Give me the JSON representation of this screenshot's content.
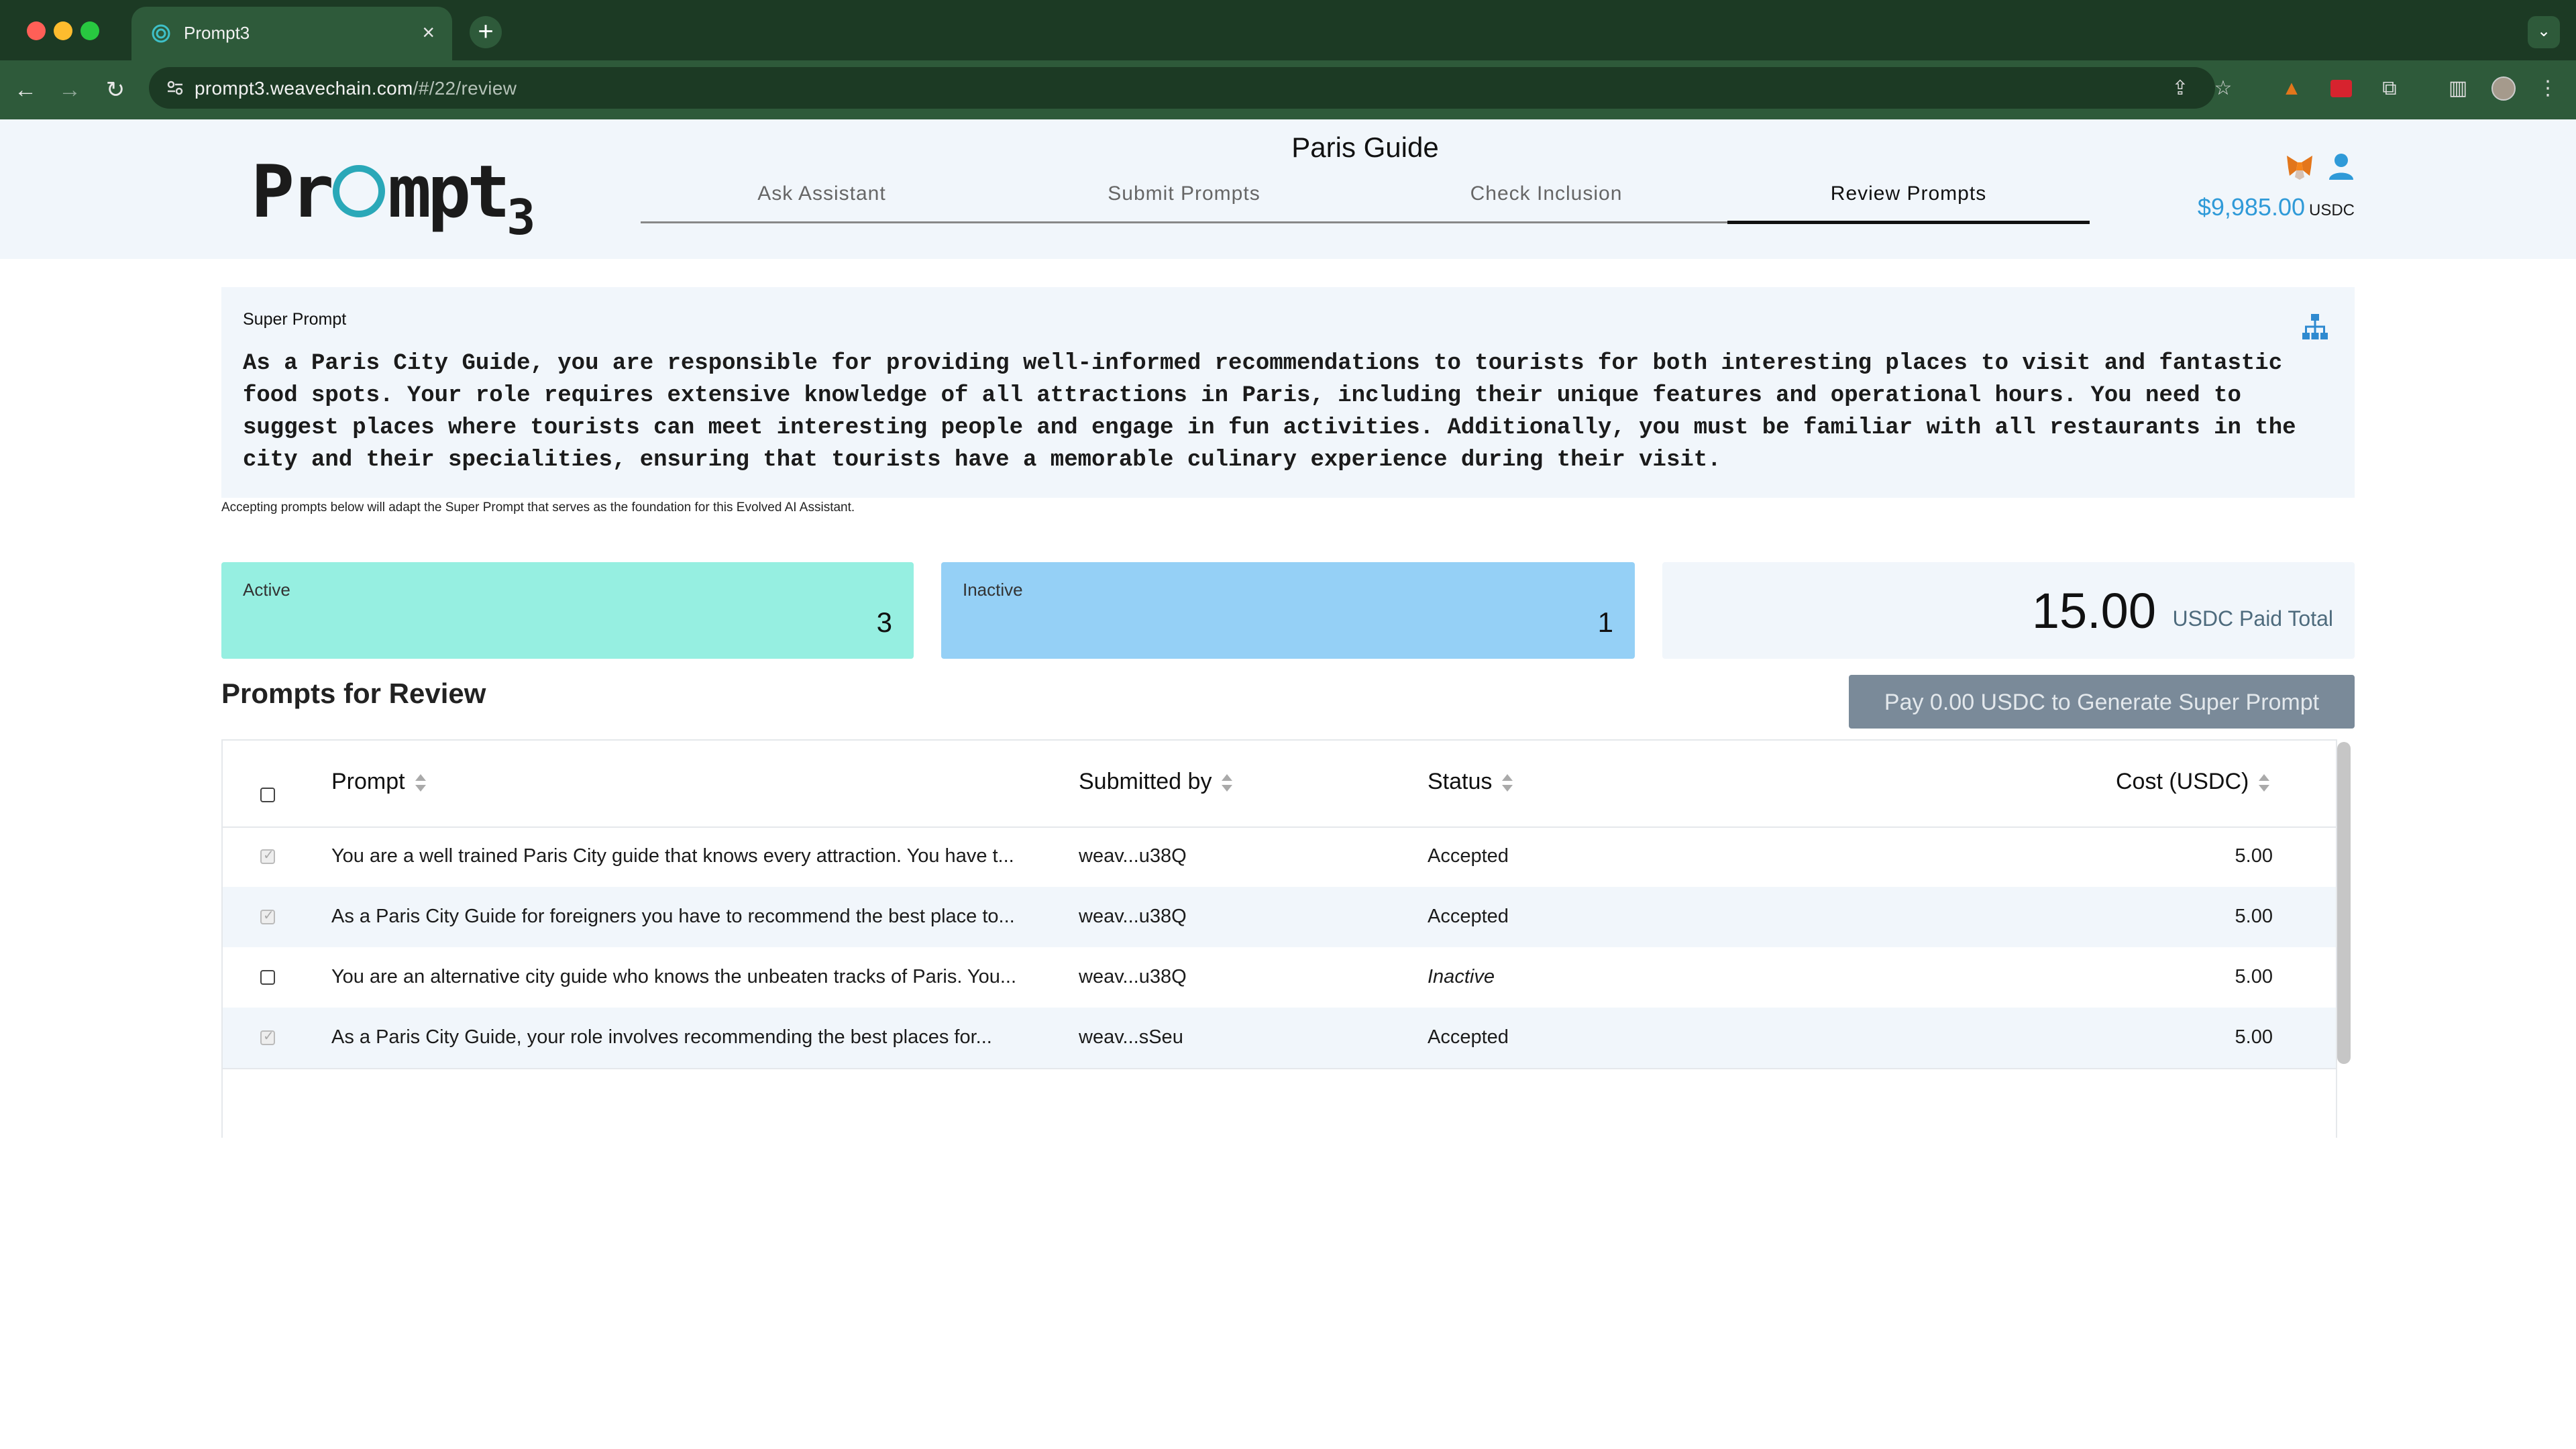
{
  "browser": {
    "tab_title": "Prompt3",
    "tab_close": "×",
    "new_tab": "+",
    "url_host": "prompt3.weavechain.com",
    "url_path": "/#/22/review"
  },
  "header": {
    "logo": "Prompt3",
    "page_title": "Paris Guide",
    "tabs": [
      {
        "label": "Ask Assistant"
      },
      {
        "label": "Submit Prompts"
      },
      {
        "label": "Check Inclusion"
      },
      {
        "label": "Review Prompts"
      }
    ],
    "active_tab": "Review Prompts",
    "balance": "$9,985.00",
    "balance_unit": "USDC"
  },
  "super_prompt": {
    "label": "Super Prompt",
    "text": "As a Paris City Guide, you are responsible for providing well-informed recommendations to tourists for both interesting places to visit and fantastic food spots. Your role requires extensive knowledge of all attractions in Paris, including their unique features and operational hours. You need to suggest places where tourists can meet interesting people and engage in fun activities. Additionally, you must be familiar with all restaurants in the city and their specialities, ensuring that tourists have a memorable culinary experience during their visit.",
    "note": "Accepting prompts below will adapt the Super Prompt that serves as the foundation for this Evolved AI Assistant."
  },
  "stats": {
    "active_label": "Active",
    "active_value": "3",
    "inactive_label": "Inactive",
    "inactive_value": "1",
    "total_value": "15.00",
    "total_label": "USDC Paid Total"
  },
  "review": {
    "title": "Prompts for Review",
    "pay_button": "Pay 0.00 USDC to Generate Super Prompt",
    "columns": {
      "prompt": "Prompt",
      "submitted_by": "Submitted by",
      "status": "Status",
      "cost": "Cost (USDC)"
    },
    "rows": [
      {
        "prompt": "You are a well trained Paris City guide that knows every attraction. You have t...",
        "submitted_by": "weav...u38Q",
        "status": "Accepted",
        "cost": "5.00",
        "checked": true
      },
      {
        "prompt": "As a Paris City Guide for foreigners you have to recommend the best place to...",
        "submitted_by": "weav...u38Q",
        "status": "Accepted",
        "cost": "5.00",
        "checked": true
      },
      {
        "prompt": "You are an alternative city guide who knows the unbeaten tracks of Paris. You...",
        "submitted_by": "weav...u38Q",
        "status": "Inactive",
        "cost": "5.00",
        "checked": false
      },
      {
        "prompt": "As a Paris City Guide, your role involves recommending the best places for...",
        "submitted_by": "weav...sSeu",
        "status": "Accepted",
        "cost": "5.00",
        "checked": true
      }
    ]
  },
  "colors": {
    "browser_dark": "#1c3a24",
    "browser_mid": "#2e5a3a",
    "header_bg": "#f1f6fb",
    "active_card": "#96efe1",
    "inactive_card": "#95d0f6",
    "balance": "#2f9ad8",
    "pay_button": "#7a8a99"
  }
}
